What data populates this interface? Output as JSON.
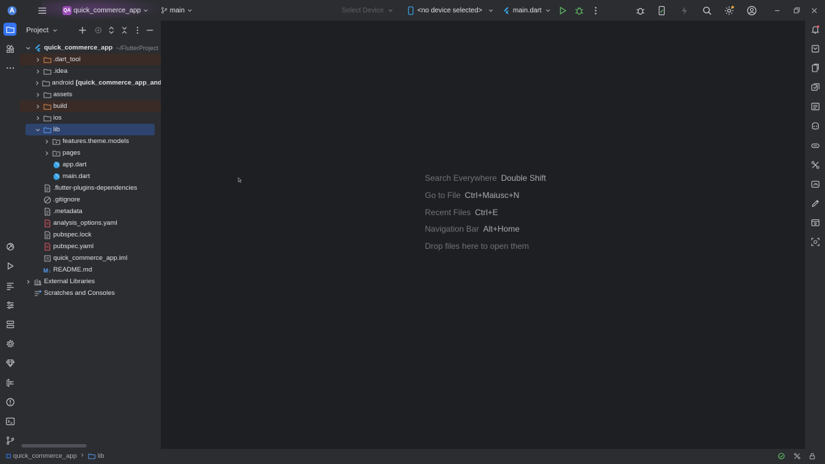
{
  "toolbar": {
    "project_badge": "QA",
    "project_name": "quick_commerce_app",
    "branch": "main",
    "select_device": "Select Device",
    "device": "<no device selected>",
    "run_config": "main.dart"
  },
  "project_panel": {
    "title": "Project",
    "tree": [
      {
        "label": "quick_commerce_app",
        "hint": "~/FlutterProject",
        "bold": true,
        "depth": 0,
        "arrow": "down",
        "icon": "flutter-module-icon"
      },
      {
        "label": ".dart_tool",
        "depth": 1,
        "arrow": "right",
        "icon": "folder-excluded-icon",
        "excluded": true
      },
      {
        "label": ".idea",
        "depth": 1,
        "arrow": "right",
        "icon": "folder-icon"
      },
      {
        "label": "android",
        "suffix": "[quick_commerce_app_and",
        "depth": 1,
        "arrow": "right",
        "icon": "folder-icon"
      },
      {
        "label": "assets",
        "depth": 1,
        "arrow": "right",
        "icon": "folder-icon"
      },
      {
        "label": "build",
        "depth": 1,
        "arrow": "right",
        "icon": "folder-excluded-icon",
        "excluded": true
      },
      {
        "label": "ios",
        "depth": 1,
        "arrow": "right",
        "icon": "folder-icon"
      },
      {
        "label": "lib",
        "depth": 1,
        "arrow": "down",
        "icon": "folder-source-icon",
        "selected": true
      },
      {
        "label": "features.theme.models",
        "depth": 2,
        "arrow": "right",
        "icon": "package-icon"
      },
      {
        "label": "pages",
        "depth": 2,
        "arrow": "right",
        "icon": "package-icon"
      },
      {
        "label": "app.dart",
        "depth": 2,
        "arrow": "none",
        "icon": "dart-file-icon"
      },
      {
        "label": "main.dart",
        "depth": 2,
        "arrow": "none",
        "icon": "dart-file-icon"
      },
      {
        "label": ".flutter-plugins-dependencies",
        "depth": 1,
        "arrow": "none",
        "icon": "text-file-icon"
      },
      {
        "label": ".gitignore",
        "depth": 1,
        "arrow": "none",
        "icon": "gitignore-icon"
      },
      {
        "label": ".metadata",
        "depth": 1,
        "arrow": "none",
        "icon": "text-file-icon"
      },
      {
        "label": "analysis_options.yaml",
        "depth": 1,
        "arrow": "none",
        "icon": "yaml-file-icon"
      },
      {
        "label": "pubspec.lock",
        "depth": 1,
        "arrow": "none",
        "icon": "text-file-icon"
      },
      {
        "label": "pubspec.yaml",
        "depth": 1,
        "arrow": "none",
        "icon": "yaml-file-icon"
      },
      {
        "label": "quick_commerce_app.iml",
        "depth": 1,
        "arrow": "none",
        "icon": "iml-file-icon"
      },
      {
        "label": "README.md",
        "depth": 1,
        "arrow": "none",
        "icon": "markdown-file-icon"
      },
      {
        "label": "External Libraries",
        "depth": 0,
        "arrow": "right",
        "icon": "library-icon"
      },
      {
        "label": "Scratches and Consoles",
        "depth": 0,
        "arrow": "none",
        "icon": "scratches-icon"
      }
    ]
  },
  "editor": {
    "hints": [
      {
        "label": "Search Everywhere",
        "key": "Double Shift"
      },
      {
        "label": "Go to File",
        "key": "Ctrl+Maiusc+N"
      },
      {
        "label": "Recent Files",
        "key": "Ctrl+E"
      },
      {
        "label": "Navigation Bar",
        "key": "Alt+Home"
      },
      {
        "label": "Drop files here to open them",
        "key": ""
      }
    ]
  },
  "statusbar": {
    "crumb_project": "quick_commerce_app",
    "crumb_folder": "lib"
  },
  "colors": {
    "accent": "#3574f0",
    "project_badge": "#9b4fb8",
    "selection": "#2e436e",
    "excluded_row": "#3a2b27",
    "dart": "#3aa4e8",
    "run_green": "#5fb865"
  }
}
